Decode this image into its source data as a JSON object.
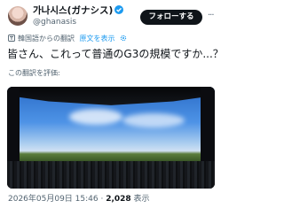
{
  "author": {
    "display_name": "가나시스(ガナシス)",
    "handle": "@ghanasis",
    "avatar_icon": "user-avatar"
  },
  "follow_label": "フォローする",
  "more_label": "···",
  "translation": {
    "note": "韓国語からの翻訳",
    "show_original": "原文を表示"
  },
  "tweet_text": "皆さん、これって普通のG3の規模ですか...？",
  "rate_translation": "この翻訳を評価:",
  "footer": {
    "date": "2026年05月09日 15:46",
    "separator": " · ",
    "views_count": "2,028",
    "views_label": " 表示"
  },
  "colors": {
    "accent": "#1d9bf0",
    "text": "#0f1419",
    "muted": "#536471",
    "button_bg": "#0f1419"
  }
}
